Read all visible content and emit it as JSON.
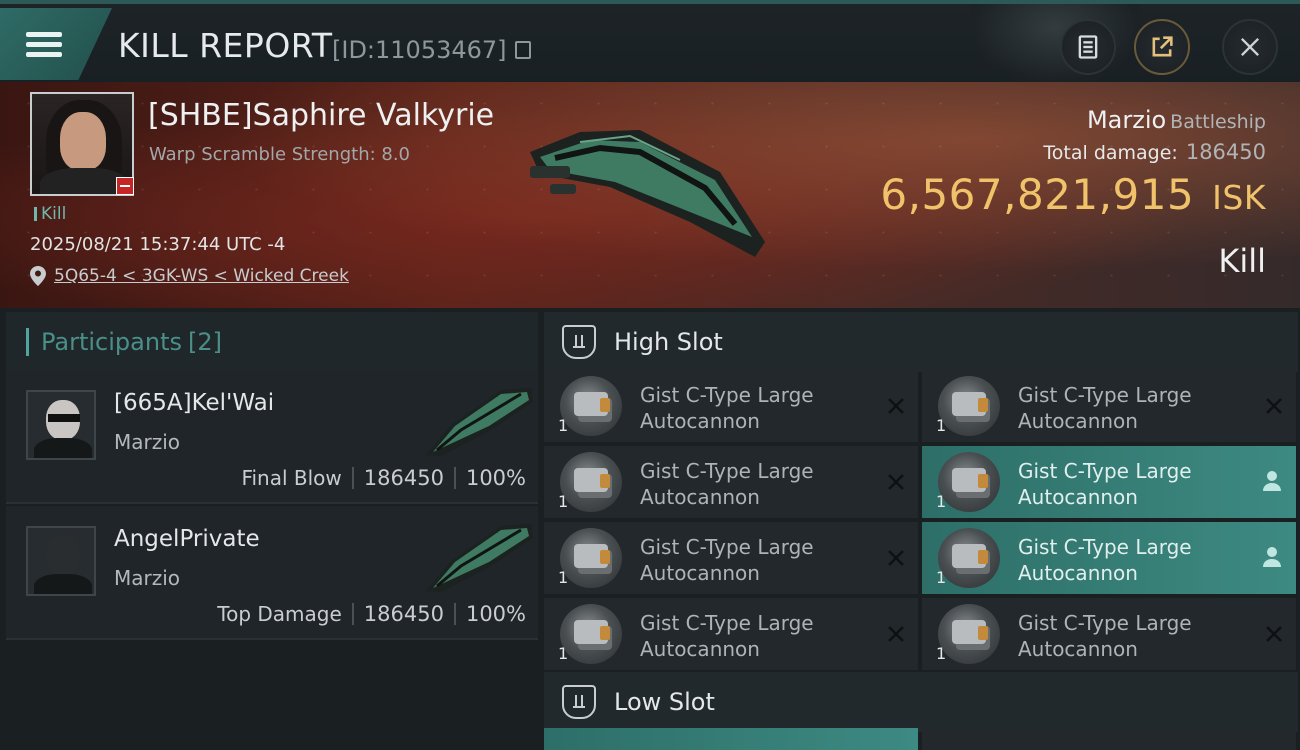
{
  "header": {
    "title": "KILL REPORT",
    "kill_id": "[ID:11053467]"
  },
  "victim": {
    "name": "[SHBE]Saphire Valkyrie",
    "subtitle": "Warp Scramble Strength: 8.0",
    "tag": "Kill",
    "datetime": "2025/08/21 15:37:44 UTC -4",
    "location": "5Q65-4 < 3GK-WS < Wicked Creek"
  },
  "ship": {
    "name": "Marzio",
    "class": "Battleship",
    "total_damage_label": "Total damage:",
    "total_damage": "186450",
    "isk_value": "6,567,821,915",
    "isk_unit": "ISK",
    "result": "Kill"
  },
  "participants": {
    "label": "Participants",
    "count": "[2]",
    "items": [
      {
        "name": "[665A]Kel'Wai",
        "ship": "Marzio",
        "role": "Final Blow",
        "damage": "186450",
        "percent": "100%"
      },
      {
        "name": "AngelPrivate",
        "ship": "Marzio",
        "role": "Top Damage",
        "damage": "186450",
        "percent": "100%"
      }
    ]
  },
  "slots": {
    "high_label": "High Slot",
    "low_label": "Low Slot",
    "high_modules": [
      {
        "name_1": "Gist C-Type Large",
        "name_2": "Autocannon",
        "qty": "1",
        "state": "destroyed"
      },
      {
        "name_1": "Gist C-Type Large",
        "name_2": "Autocannon",
        "qty": "1",
        "state": "destroyed"
      },
      {
        "name_1": "Gist C-Type Large",
        "name_2": "Autocannon",
        "qty": "1",
        "state": "destroyed"
      },
      {
        "name_1": "Gist C-Type Large",
        "name_2": "Autocannon",
        "qty": "1",
        "state": "dropped"
      },
      {
        "name_1": "Gist C-Type Large",
        "name_2": "Autocannon",
        "qty": "1",
        "state": "destroyed"
      },
      {
        "name_1": "Gist C-Type Large",
        "name_2": "Autocannon",
        "qty": "1",
        "state": "dropped"
      },
      {
        "name_1": "Gist C-Type Large",
        "name_2": "Autocannon",
        "qty": "1",
        "state": "destroyed"
      },
      {
        "name_1": "Gist C-Type Large",
        "name_2": "Autocannon",
        "qty": "1",
        "state": "destroyed"
      }
    ]
  },
  "colors": {
    "accent": "#4ea69c",
    "isk": "#f0c36b",
    "highlight": "#3d8a82",
    "destroyed_badge": "#c52626"
  },
  "icons": {
    "menu": "hamburger-icon",
    "copy": "copy-icon",
    "clipboard": "clipboard-icon",
    "share": "share-icon",
    "close": "close-icon",
    "pin": "location-pin-icon",
    "slot": "high-slot-icon",
    "module_destroyed": "x-icon",
    "module_dropped": "person-icon"
  }
}
